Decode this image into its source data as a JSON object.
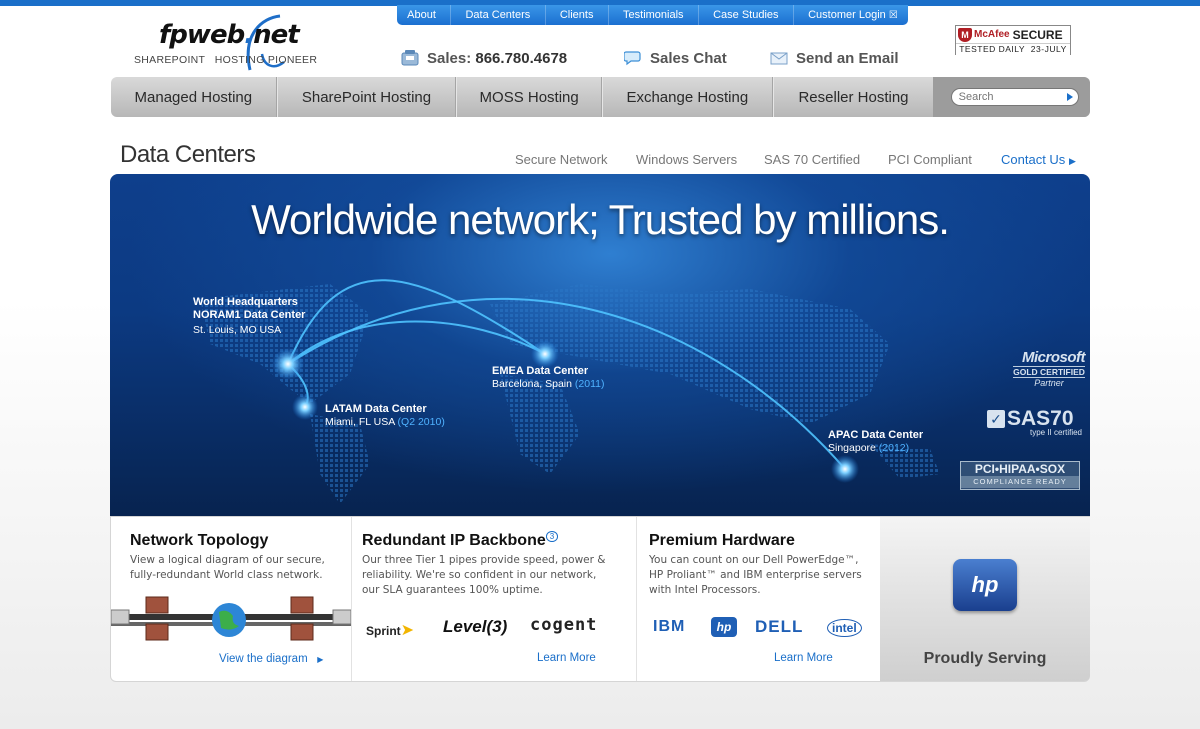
{
  "topnav": {
    "items": [
      "About",
      "Data Centers",
      "Clients",
      "Testimonials",
      "Case Studies",
      "Customer Login"
    ]
  },
  "logo": {
    "name": "fpweb",
    "dot": ".",
    "suffix": "net",
    "tagline": "SHAREPOINT   HOSTING PIONEER"
  },
  "contact": {
    "sales_label": "Sales:",
    "sales_phone": "866.780.4678",
    "chat": "Sales Chat",
    "email": "Send an Email"
  },
  "mcafee": {
    "brand": "McAfee",
    "secure": "SECURE",
    "tested": "TESTED DAILY",
    "date": "23-JULY"
  },
  "mainnav": {
    "items": [
      "Managed Hosting",
      "SharePoint Hosting",
      "MOSS Hosting",
      "Exchange Hosting",
      "Reseller Hosting"
    ],
    "search_placeholder": "Search"
  },
  "page": {
    "title": "Data Centers",
    "subnav": [
      "Secure Network",
      "Windows Servers",
      "SAS 70 Certified",
      "PCI Compliant",
      "Contact Us"
    ]
  },
  "hero": {
    "headline": "Worldwide network; Trusted by millions.",
    "locations": {
      "hq": {
        "l1": "World Headquarters",
        "l2": "NORAM1 Data Center",
        "l3": "St. Louis, MO USA"
      },
      "latam": {
        "name": "LATAM Data Center",
        "city": "Miami, FL USA",
        "year": "(Q2 2010)"
      },
      "emea": {
        "name": "EMEA Data Center",
        "city": "Barcelona, Spain",
        "year": "(2011)"
      },
      "apac": {
        "name": "APAC Data Center",
        "city": "Singapore",
        "year": "(2012)"
      }
    },
    "badges": {
      "ms_name": "Microsoft",
      "ms_gold": "GOLD CERTIFIED",
      "ms_partner": "Partner",
      "sas": "SAS70",
      "sas_type": "type II certified",
      "pci": "PCI•HIPAA•SOX",
      "pci_sub": "COMPLIANCE READY"
    }
  },
  "features": {
    "topology": {
      "title": "Network Topology",
      "desc": "View a logical diagram of our secure, fully-redundant World class network.",
      "link": "View the diagram"
    },
    "backbone": {
      "title": "Redundant IP Backbone",
      "sup": "3",
      "desc": "Our three Tier 1 pipes provide speed, power & reliability. We're so confident in our network, our SLA guarantees 100% uptime.",
      "logos": [
        "Sprint",
        "Level(3)",
        "cogent"
      ],
      "link": "Learn More"
    },
    "hardware": {
      "title": "Premium Hardware",
      "desc": "You can count on our Dell PowerEdge™, HP Proliant™ and IBM enterprise servers with Intel Processors.",
      "logos": [
        "IBM",
        "hp",
        "DELL",
        "intel"
      ],
      "link": "Learn More"
    },
    "proud": {
      "logo": "hp",
      "caption": "Proudly Serving"
    }
  },
  "colors": {
    "brand_blue": "#1a6fc9",
    "nav_gray": "#c8c8c8",
    "hero_dark": "#07234f"
  }
}
